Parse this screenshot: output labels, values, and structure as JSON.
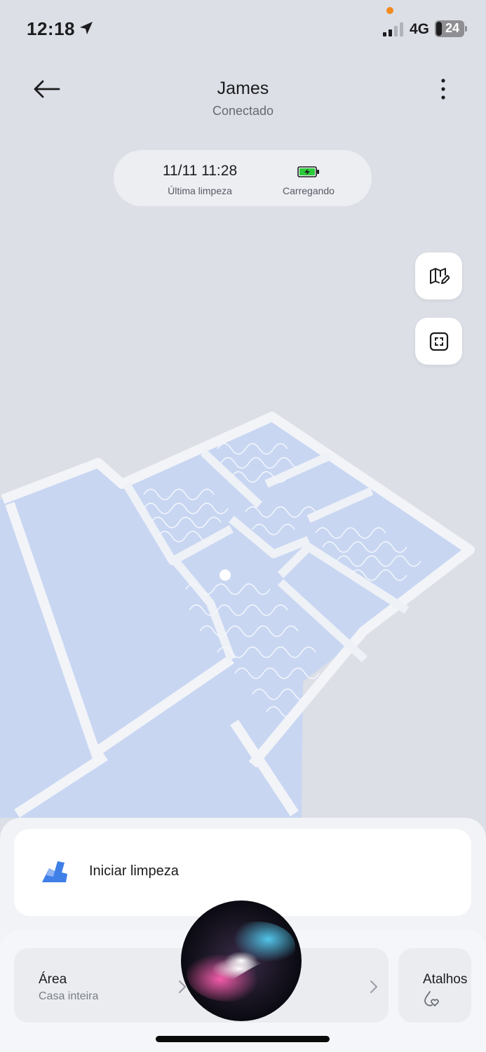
{
  "status_bar": {
    "time": "12:18",
    "network": "4G",
    "battery_level": "24",
    "signal_bars": 2
  },
  "header": {
    "title": "James",
    "subtitle": "Conectado",
    "back_icon": "arrow-left-icon",
    "menu_icon": "more-vertical-icon"
  },
  "info": {
    "last_clean_value": "11/11 11:28",
    "last_clean_label": "Última limpeza",
    "charging_label": "Carregando",
    "charging_icon": "battery-charging-icon"
  },
  "map_tools": {
    "edit_map_icon": "map-edit-icon",
    "focus_icon": "focus-frame-icon"
  },
  "actions": {
    "start_label": "Iniciar limpeza",
    "start_icon": "robot-mop-icon"
  },
  "area": {
    "title": "Área",
    "value": "Casa inteira"
  },
  "shortcuts": {
    "title": "Atalhos",
    "icon": "drop-heart-icon"
  },
  "colors": {
    "background": "#dcdfe6",
    "map_floor": "#c8d6f2",
    "map_wall": "#f2f4f8",
    "accent_blue": "#3f7fe8",
    "charge_green": "#2bcb3a"
  }
}
